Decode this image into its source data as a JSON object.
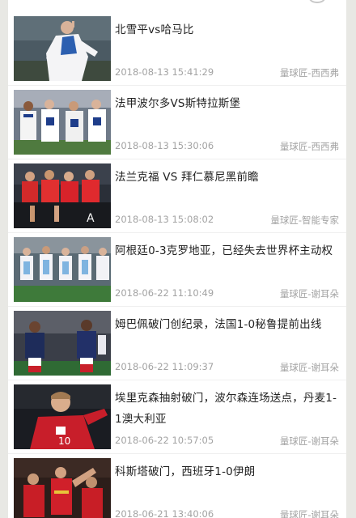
{
  "articles": [
    {
      "title": "北雪平vs哈马比",
      "date": "2018-08-13 15:41:29",
      "source": "量球匠-西西弗"
    },
    {
      "title": "法甲波尔多VS斯特拉斯堡",
      "date": "2018-08-13 15:30:06",
      "source": "量球匠-西西弗"
    },
    {
      "title": "法兰克福 VS 拜仁慕尼黑前瞻",
      "date": "2018-08-13 15:08:02",
      "source": "量球匠-智能专家"
    },
    {
      "title": "阿根廷0-3克罗地亚，已经失去世界杯主动权",
      "date": "2018-06-22 11:10:49",
      "source": "量球匠-谢耳朵"
    },
    {
      "title": "姆巴佩破门创纪录，法国1-0秘鲁提前出线",
      "date": "2018-06-22 11:09:37",
      "source": "量球匠-谢耳朵"
    },
    {
      "title": "埃里克森抽射破门，波尔森连场送点，丹麦1-1澳大利亚",
      "date": "2018-06-22 10:57:05",
      "source": "量球匠-谢耳朵"
    },
    {
      "title": "科斯塔破门，西班牙1-0伊朗",
      "date": "2018-06-21 13:40:06",
      "source": "量球匠-谢耳朵"
    }
  ]
}
